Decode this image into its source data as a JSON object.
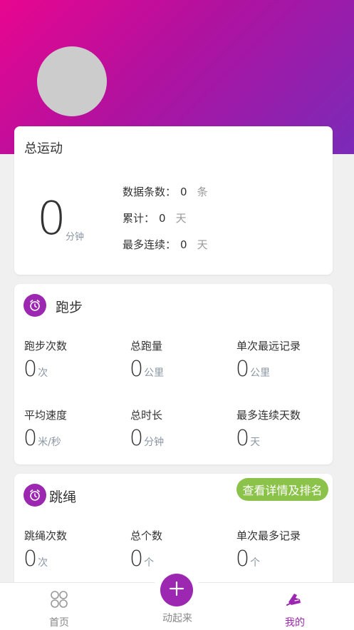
{
  "summary": {
    "title": "总运动",
    "total_value": "0",
    "total_unit": "分钟",
    "lines": [
      {
        "label": "数据条数：",
        "value": "0",
        "unit": "条"
      },
      {
        "label": "累计：",
        "value": "0",
        "unit": "天"
      },
      {
        "label": "最多连续：",
        "value": "0",
        "unit": "天"
      }
    ]
  },
  "running": {
    "title": "跑步",
    "metrics": [
      {
        "label": "跑步次数",
        "value": "0",
        "unit": "次"
      },
      {
        "label": "总跑量",
        "value": "0",
        "unit": "公里"
      },
      {
        "label": "单次最远记录",
        "value": "0",
        "unit": "公里"
      },
      {
        "label": "平均速度",
        "value": "0",
        "unit": "米/秒"
      },
      {
        "label": "总时长",
        "value": "0",
        "unit": "分钟"
      },
      {
        "label": "最多连续天数",
        "value": "0",
        "unit": "天"
      }
    ]
  },
  "rope": {
    "title": "跳绳",
    "detail_button": "查看详情及排名",
    "metrics": [
      {
        "label": "跳绳次数",
        "value": "0",
        "unit": "次"
      },
      {
        "label": "总个数",
        "value": "0",
        "unit": "个"
      },
      {
        "label": "单次最多记录",
        "value": "0",
        "unit": "个"
      }
    ]
  },
  "tabbar": {
    "home": "首页",
    "center": "动起来",
    "mine": "我的"
  },
  "colors": {
    "accent": "#9c27b0",
    "button_green": "#8bc34a",
    "gradient_start": "#e8068f",
    "gradient_end": "#7a2bb8"
  }
}
